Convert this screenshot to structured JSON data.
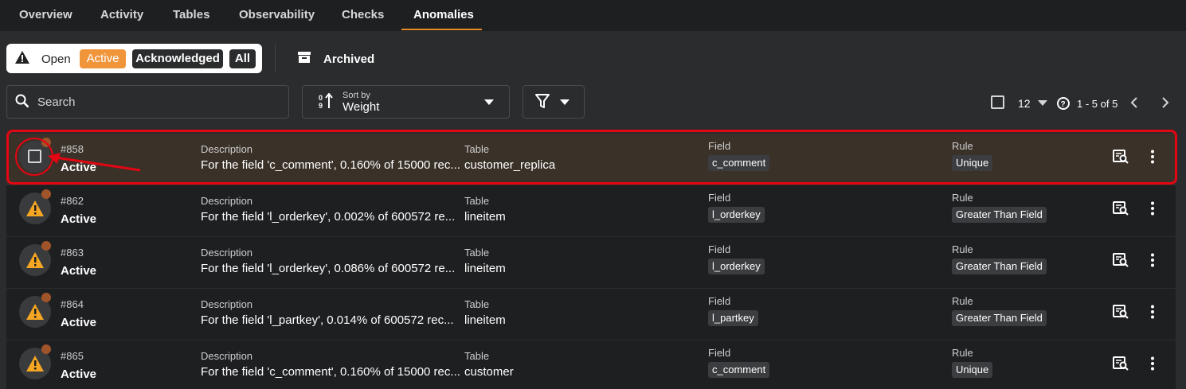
{
  "tabs": [
    "Overview",
    "Activity",
    "Tables",
    "Observability",
    "Checks",
    "Anomalies"
  ],
  "status_filter": {
    "open_label": "Open",
    "active": "Active",
    "acknowledged": "Acknowledged",
    "all": "All"
  },
  "archived_label": "Archived",
  "search": {
    "placeholder": "Search"
  },
  "sort": {
    "caption": "Sort by",
    "value": "Weight"
  },
  "pagination": {
    "page_size": "12",
    "range": "1 - 5 of 5"
  },
  "columns": {
    "description": "Description",
    "table": "Table",
    "field": "Field",
    "rule": "Rule"
  },
  "rows": [
    {
      "id": "#858",
      "status": "Active",
      "description": "For the field 'c_comment', 0.160% of 15000 rec...",
      "table": "customer_replica",
      "field": "c_comment",
      "rule": "Unique"
    },
    {
      "id": "#862",
      "status": "Active",
      "description": "For the field 'l_orderkey', 0.002% of 600572 re...",
      "table": "lineitem",
      "field": "l_orderkey",
      "rule": "Greater Than Field"
    },
    {
      "id": "#863",
      "status": "Active",
      "description": "For the field 'l_orderkey', 0.086% of 600572 re...",
      "table": "lineitem",
      "field": "l_orderkey",
      "rule": "Greater Than Field"
    },
    {
      "id": "#864",
      "status": "Active",
      "description": "For the field 'l_partkey', 0.014% of 600572 rec...",
      "table": "lineitem",
      "field": "l_partkey",
      "rule": "Greater Than Field"
    },
    {
      "id": "#865",
      "status": "Active",
      "description": "For the field 'c_comment', 0.160% of 15000 rec...",
      "table": "customer",
      "field": "c_comment",
      "rule": "Unique"
    }
  ],
  "colors": {
    "accent": "#f0953a",
    "highlight": "#e30613",
    "warning": "#f5a623"
  }
}
